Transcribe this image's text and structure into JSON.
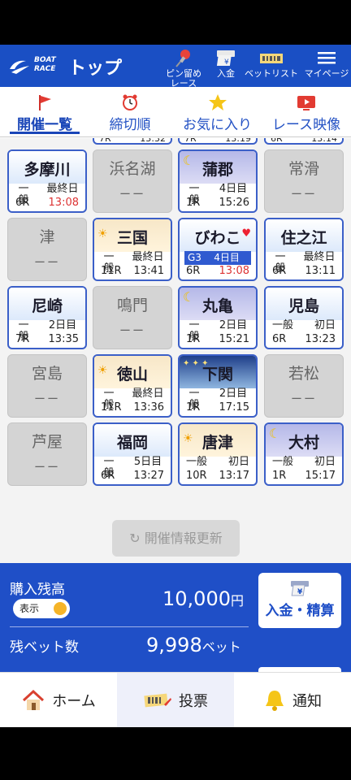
{
  "header": {
    "logo_text": "BOAT\nRACE",
    "title": "トップ",
    "pin_label": "ピン留め\nレース",
    "deposit_label": "入金",
    "betlist_label": "ベットリスト",
    "mypage_label": "マイページ"
  },
  "tabs": [
    {
      "label": "開催一覧"
    },
    {
      "label": "締切順"
    },
    {
      "label": "お気に入り"
    },
    {
      "label": "レース映像"
    }
  ],
  "top_strip": [
    {
      "race": "7R",
      "time": "13:32"
    },
    {
      "race": "7R",
      "time": "13:19"
    },
    {
      "race": "6R",
      "time": "13:14"
    }
  ],
  "venues": [
    {
      "name": "多摩川",
      "open": true,
      "grade": "一般",
      "day": "最終日",
      "race": "6R",
      "time": "13:08",
      "red": true
    },
    {
      "name": "浜名湖",
      "open": false,
      "dash": "ーー"
    },
    {
      "name": "蒲郡",
      "open": true,
      "grade": "一般",
      "day": "4日目",
      "race": "1R",
      "time": "15:26",
      "night": true
    },
    {
      "name": "常滑",
      "open": false,
      "dash": "ーー"
    },
    {
      "name": "津",
      "open": false,
      "dash": "ーー"
    },
    {
      "name": "三国",
      "open": true,
      "grade": "一般",
      "day": "最終日",
      "race": "11R",
      "time": "13:41",
      "sun": true
    },
    {
      "name": "びわこ",
      "open": true,
      "grade": "G3",
      "day": "4日目",
      "race": "6R",
      "time": "13:08",
      "red": true,
      "fav": true
    },
    {
      "name": "住之江",
      "open": true,
      "grade": "一般",
      "day": "最終日",
      "race": "6R",
      "time": "13:11"
    },
    {
      "name": "尼崎",
      "open": true,
      "grade": "一般",
      "day": "2日目",
      "race": "7R",
      "time": "13:35"
    },
    {
      "name": "鳴門",
      "open": false,
      "dash": "ーー"
    },
    {
      "name": "丸亀",
      "open": true,
      "grade": "一般",
      "day": "2日目",
      "race": "1R",
      "time": "15:21",
      "night": true
    },
    {
      "name": "児島",
      "open": true,
      "grade": "一般",
      "day": "初日",
      "race": "6R",
      "time": "13:23"
    },
    {
      "name": "宮島",
      "open": false,
      "dash": "ーー"
    },
    {
      "name": "徳山",
      "open": true,
      "grade": "一般",
      "day": "最終日",
      "race": "11R",
      "time": "13:36",
      "sun": true
    },
    {
      "name": "下関",
      "open": true,
      "grade": "一般",
      "day": "2日目",
      "race": "1R",
      "time": "17:15",
      "stars": true
    },
    {
      "name": "若松",
      "open": false,
      "dash": "ーー"
    },
    {
      "name": "芦屋",
      "open": false,
      "dash": "ーー"
    },
    {
      "name": "福岡",
      "open": true,
      "grade": "一般",
      "day": "5日目",
      "race": "6R",
      "time": "13:27"
    },
    {
      "name": "唐津",
      "open": true,
      "grade": "一般",
      "day": "初日",
      "race": "10R",
      "time": "13:17",
      "sun": true
    },
    {
      "name": "大村",
      "open": true,
      "grade": "一般",
      "day": "初日",
      "race": "1R",
      "time": "15:17",
      "night": true
    }
  ],
  "refresh_label": "開催情報更新",
  "balance": {
    "label": "購入残高",
    "toggle_label": "表示",
    "value": "10,000",
    "unit": "円",
    "bet_label": "残ベット数",
    "bet_value": "9,998",
    "bet_unit": "ベット",
    "deposit_button": "入金・精算"
  },
  "bottom_nav": [
    {
      "label": "ホーム"
    },
    {
      "label": "投票"
    },
    {
      "label": "通知"
    }
  ],
  "colors": {
    "brand": "#1a4fc4",
    "deadline_red": "#dd3333",
    "toggle_knob": "#f5b428"
  }
}
